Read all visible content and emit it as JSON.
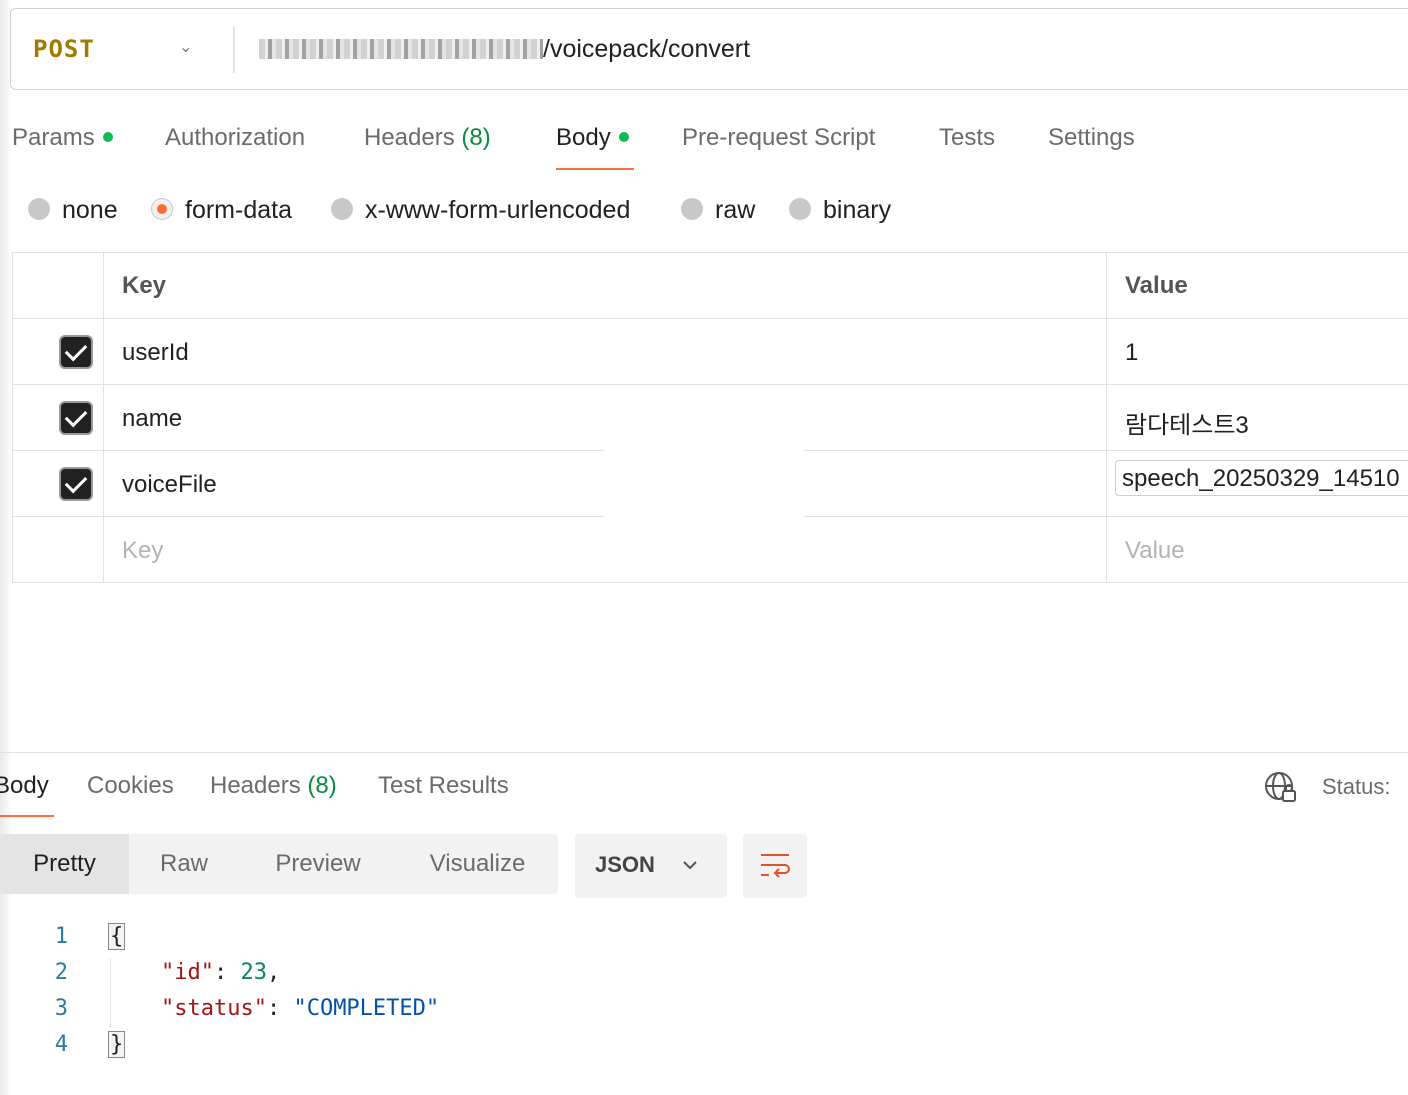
{
  "request": {
    "method": "POST",
    "url_suffix": "/voicepack/convert"
  },
  "request_tabs": [
    {
      "label": "Params",
      "dot": true
    },
    {
      "label": "Authorization"
    },
    {
      "label": "Headers",
      "count": "(8)"
    },
    {
      "label": "Body",
      "dot": true,
      "active": true
    },
    {
      "label": "Pre-request Script"
    },
    {
      "label": "Tests"
    },
    {
      "label": "Settings"
    }
  ],
  "body_types": [
    "none",
    "form-data",
    "x-www-form-urlencoded",
    "raw",
    "binary"
  ],
  "body_type_selected": "form-data",
  "table": {
    "headers": {
      "key": "Key",
      "value": "Value"
    },
    "rows": [
      {
        "key": "userId",
        "value": "1",
        "checked": true
      },
      {
        "key": "name",
        "value": "람다테스트3",
        "checked": true
      },
      {
        "key": "voiceFile",
        "value": "speech_20250329_14510",
        "checked": true
      }
    ],
    "placeholder": {
      "key": "Key",
      "value": "Value"
    }
  },
  "response": {
    "tabs": [
      {
        "label": "Body",
        "active": true
      },
      {
        "label": "Cookies"
      },
      {
        "label": "Headers",
        "count": "(8)"
      },
      {
        "label": "Test Results"
      }
    ],
    "status_label": "Status:",
    "view_modes": [
      "Pretty",
      "Raw",
      "Preview",
      "Visualize"
    ],
    "view_mode_selected": "Pretty",
    "format": "JSON",
    "code": {
      "line_numbers": [
        "1",
        "2",
        "3",
        "4"
      ],
      "open_brace": "{",
      "close_brace": "}",
      "id_key": "\"id\"",
      "id_value": "23",
      "status_key": "\"status\"",
      "status_value": "\"COMPLETED\""
    }
  },
  "colors": {
    "accent": "#ff6c37",
    "dot_green": "#0cbb52",
    "method": "#a37a00"
  }
}
